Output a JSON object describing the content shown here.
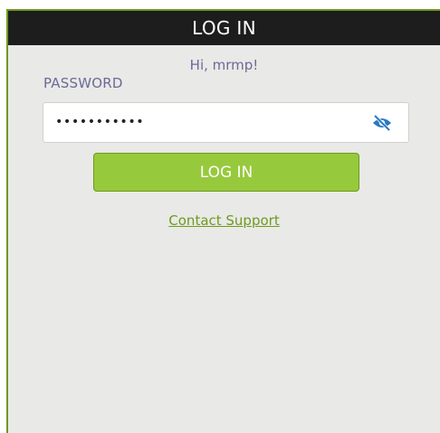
{
  "window": {
    "title": "LOG IN"
  },
  "login": {
    "greeting": "Hi, mrmp!",
    "password_label": "PASSWORD",
    "password_value": "•••••••••••",
    "show_password_icon": "eye-slash-icon",
    "submit_label": "LOG IN",
    "support_link": "Contact Support"
  },
  "colors": {
    "accent": "#97c93c",
    "accent_dark": "#6f9a1f",
    "titlebar": "#1d1d1d",
    "label": "#6c6a97",
    "background": "#e9e9e7",
    "icon": "#2a79c4"
  }
}
